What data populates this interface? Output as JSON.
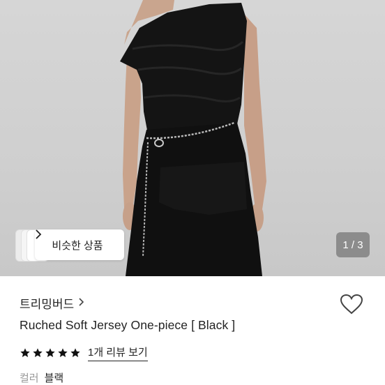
{
  "gallery": {
    "image_label": "product-photo",
    "similar_button": {
      "label": "비슷한 상품",
      "chevron": "chevron-right-icon"
    },
    "counter": "1 / 3"
  },
  "product": {
    "seller": "트리밍버드",
    "title": "Ruched Soft Jersey One-piece [ Black ]",
    "rating_stars": 5,
    "review_link": "1개 리뷰 보기",
    "color_label": "컬러",
    "color_value": "블랙"
  },
  "colors": {
    "star": "#111111",
    "text": "#222222",
    "muted": "#999999",
    "counter_bg": "#5a5a5a"
  }
}
